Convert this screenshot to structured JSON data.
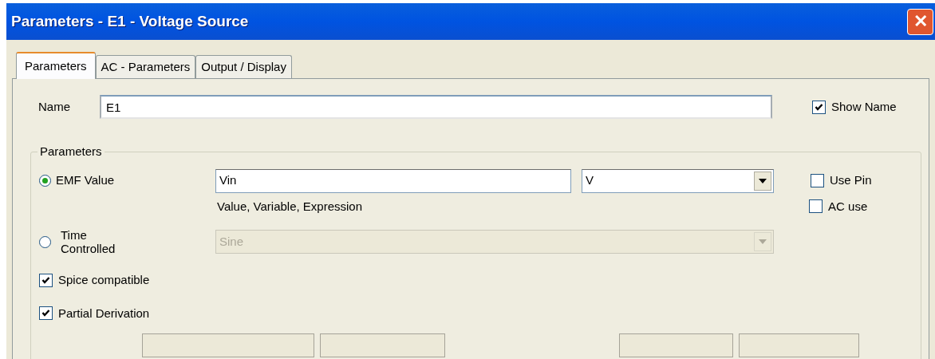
{
  "window": {
    "title": "Parameters - E1 - Voltage Source",
    "close_symbol": "✕"
  },
  "tabs": [
    {
      "label": "Parameters",
      "selected": true
    },
    {
      "label": "AC - Parameters",
      "selected": false
    },
    {
      "label": "Output / Display",
      "selected": false
    }
  ],
  "name_row": {
    "label": "Name",
    "value": "E1",
    "show_name": {
      "label": "Show Name",
      "checked": true
    }
  },
  "group": {
    "title": "Parameters",
    "emf": {
      "label": "EMF Value",
      "selected": true,
      "value": "Vin",
      "unit": "V",
      "hint": "Value, Variable, Expression"
    },
    "time_controlled": {
      "label": "Time\nControlled",
      "selected": false,
      "value": "Sine",
      "disabled": true
    },
    "side_options": [
      {
        "label": "Use Pin",
        "checked": false
      },
      {
        "label": "AC use",
        "checked": false
      }
    ],
    "options": [
      {
        "label": "Spice compatible",
        "checked": true
      },
      {
        "label": "Partial Derivation",
        "checked": true
      }
    ],
    "cut_row": [
      {
        "disabled": true
      },
      {
        "disabled": true
      },
      {
        "disabled": true
      },
      {
        "disabled": true
      }
    ]
  }
}
